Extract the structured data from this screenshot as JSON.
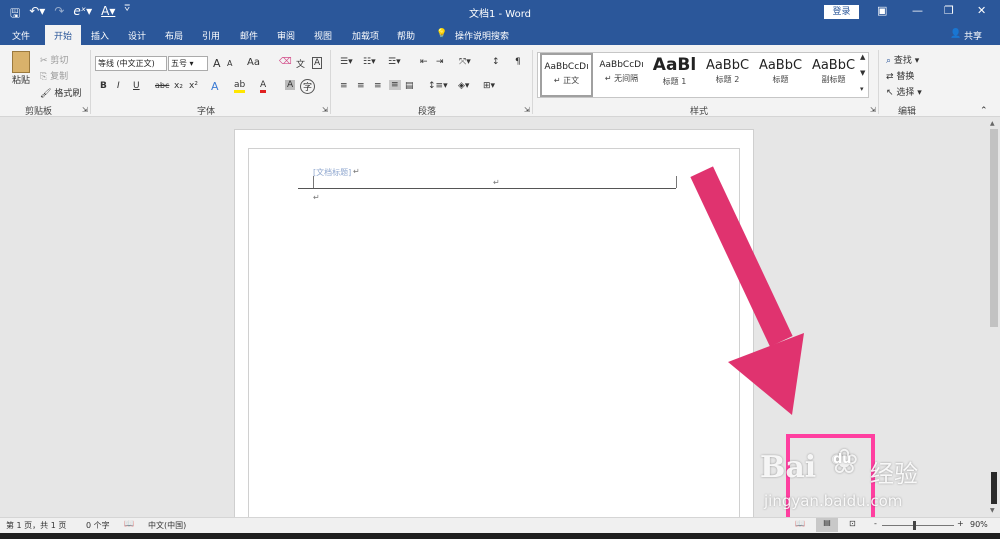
{
  "window": {
    "title": "文档1 - Word",
    "login_label": "登录",
    "share_label": "共享"
  },
  "tabs": [
    "文件",
    "开始",
    "插入",
    "设计",
    "布局",
    "引用",
    "邮件",
    "审阅",
    "视图",
    "加载项",
    "帮助"
  ],
  "tell_me": "操作说明搜索",
  "clipboard": {
    "paste": "粘贴",
    "cut": "剪切",
    "copy": "复制",
    "format_painter": "格式刷",
    "label": "剪贴板"
  },
  "font": {
    "name": "等线 (中文正文)",
    "size": "五号",
    "label": "字体",
    "grow": "A",
    "shrink": "A",
    "case": "Aa",
    "bold": "B",
    "italic": "I",
    "underline": "U",
    "strike": "abc",
    "sub": "x₂",
    "sup": "x²"
  },
  "paragraph": {
    "label": "段落"
  },
  "styles": {
    "label": "样式",
    "items": [
      {
        "preview": "AaBbCcDı",
        "name": "↵ 正文"
      },
      {
        "preview": "AaBbCcDı",
        "name": "↵ 无间隔"
      },
      {
        "preview": "AaBl",
        "name": "标题 1"
      },
      {
        "preview": "AaBbC",
        "name": "标题 2"
      },
      {
        "preview": "AaBbC",
        "name": "标题"
      },
      {
        "preview": "AaBbC",
        "name": "副标题"
      }
    ]
  },
  "editing": {
    "find": "查找",
    "replace": "替换",
    "select": "选择",
    "label": "编辑"
  },
  "document": {
    "header_placeholder": "[文档标题]",
    "para_mark": "↵"
  },
  "status": {
    "page": "第 1 页，共 1 页",
    "words": "0 个字",
    "language": "中文(中国)",
    "zoom": "90%",
    "zoom_level": 0.9
  },
  "watermark": {
    "brand": "Bai",
    "brand2": "du",
    "cn": "经验",
    "url": "jingyan.baidu.com"
  },
  "colors": {
    "accent": "#2b579a",
    "annotation": "#e0336f",
    "highlight_box": "#ff3fa0"
  }
}
